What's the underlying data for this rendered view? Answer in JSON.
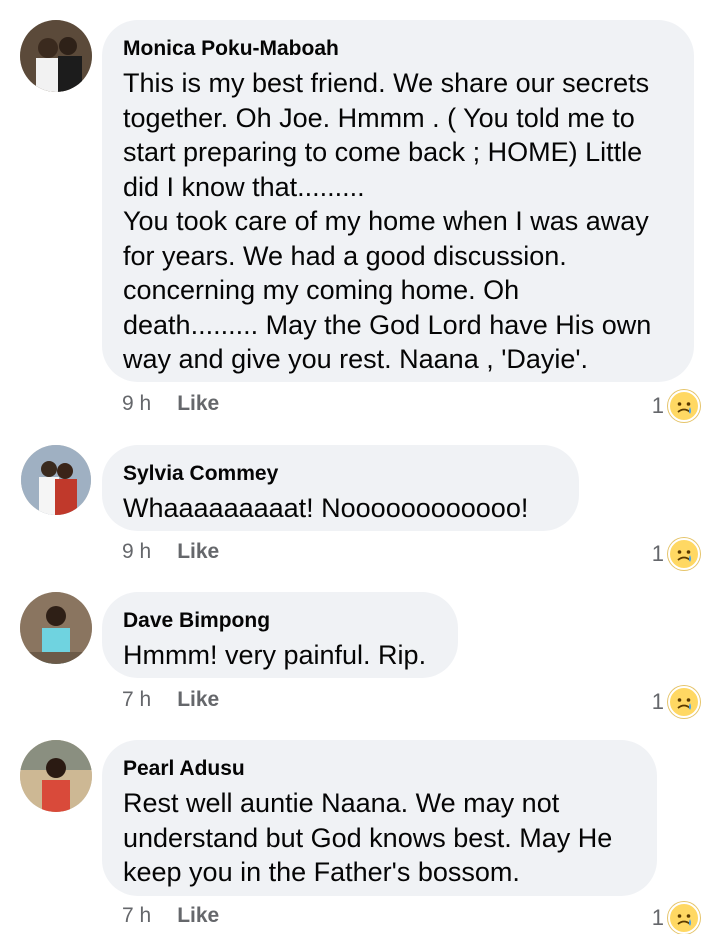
{
  "comments": [
    {
      "author": "Monica Poku-Maboah",
      "text": "This is my best friend. We share our secrets\ntogether. Oh Joe. Hmmm . ( You told me to\nstart preparing to come back ; HOME) Little\ndid I know that.........\nYou took care of my home when I was away\nfor years. We had a good discussion.\nconcerning my coming home. Oh\ndeath......... May the God Lord have His own\nway and give you rest. Naana , 'Dayie'.",
      "time": "9 h",
      "like_label": "Like",
      "reaction_count": "1",
      "reaction_icon": "sad-cry-icon"
    },
    {
      "author": "Sylvia Commey",
      "text": "Whaaaaaaaaat! Noooooooooooo!",
      "time": "9 h",
      "like_label": "Like",
      "reaction_count": "1",
      "reaction_icon": "sad-cry-icon"
    },
    {
      "author": "Dave Bimpong",
      "text": "Hmmm! very painful. Rip.",
      "time": "7 h",
      "like_label": "Like",
      "reaction_count": "1",
      "reaction_icon": "sad-cry-icon"
    },
    {
      "author": "Pearl Adusu",
      "text": "Rest well auntie Naana. We may not\nunderstand but God knows best. May He\nkeep you in the Father's bossom.",
      "time": "7 h",
      "like_label": "Like",
      "reaction_count": "1",
      "reaction_icon": "sad-cry-icon"
    }
  ]
}
